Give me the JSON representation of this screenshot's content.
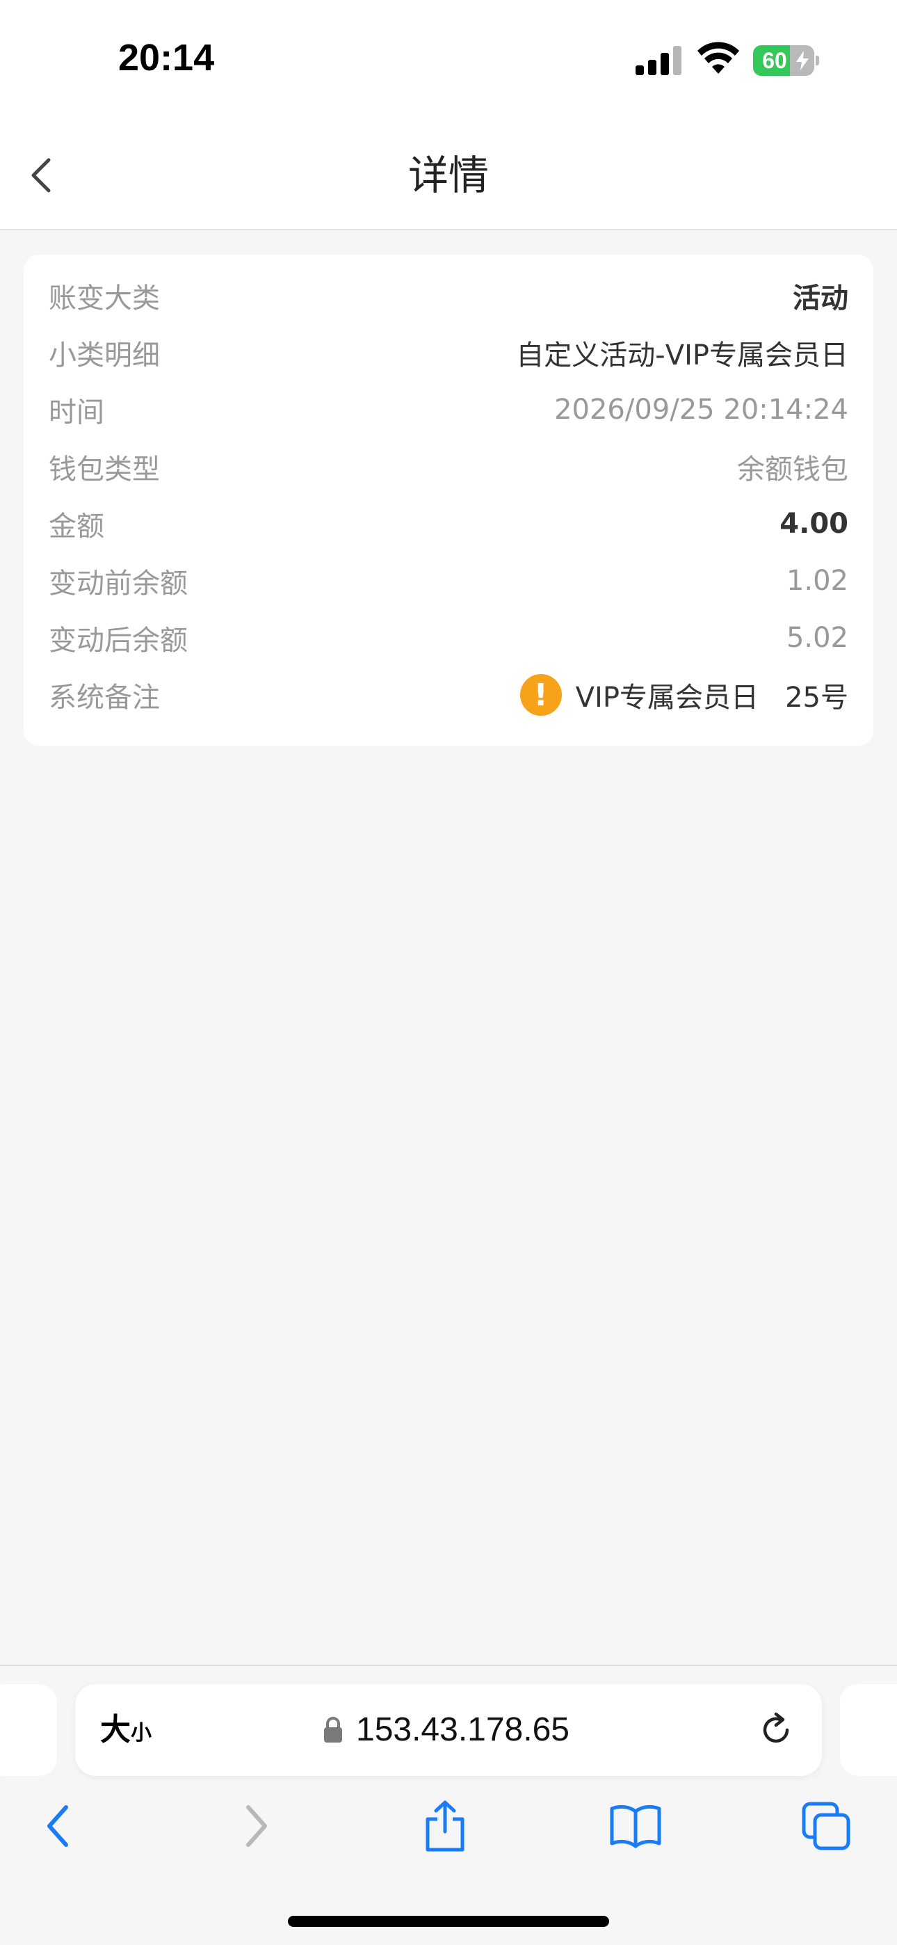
{
  "status_bar": {
    "time": "20:14",
    "battery_percent": 60,
    "battery_text": "60",
    "signal_icon": "cellular-signal-icon",
    "wifi_icon": "wifi-icon",
    "charging_icon": "charging-bolt-icon"
  },
  "nav": {
    "title": "详情",
    "back_icon": "chevron-left-icon"
  },
  "details": {
    "rows": [
      {
        "label": "账变大类",
        "value": "活动"
      },
      {
        "label": "小类明细",
        "value": "自定义活动-VIP专属会员日"
      },
      {
        "label": "时间",
        "value": "2026/09/25 20:14:24"
      },
      {
        "label": "钱包类型",
        "value": "余额钱包"
      },
      {
        "label": "金额",
        "value": "4.00"
      },
      {
        "label": "变动前余额",
        "value": "1.02"
      },
      {
        "label": "变动后余额",
        "value": "5.02"
      },
      {
        "label": "系统备注",
        "value": "VIP专属会员日   25号"
      }
    ],
    "remark_icon_text": "!",
    "remark_icon": "warning-icon"
  },
  "browser": {
    "text_size_big": "大",
    "text_size_small": "小",
    "url": "153.43.178.65",
    "lock_icon": "lock-icon",
    "reload_icon": "reload-icon",
    "toolbar": [
      "back-icon",
      "forward-icon",
      "share-icon",
      "bookmarks-icon",
      "tabs-icon"
    ]
  },
  "colors": {
    "accent": "#1a7cf5",
    "warning": "#f7a21b",
    "battery_fill": "#34c759",
    "label_gray": "#999999",
    "value_dark": "#333333"
  }
}
